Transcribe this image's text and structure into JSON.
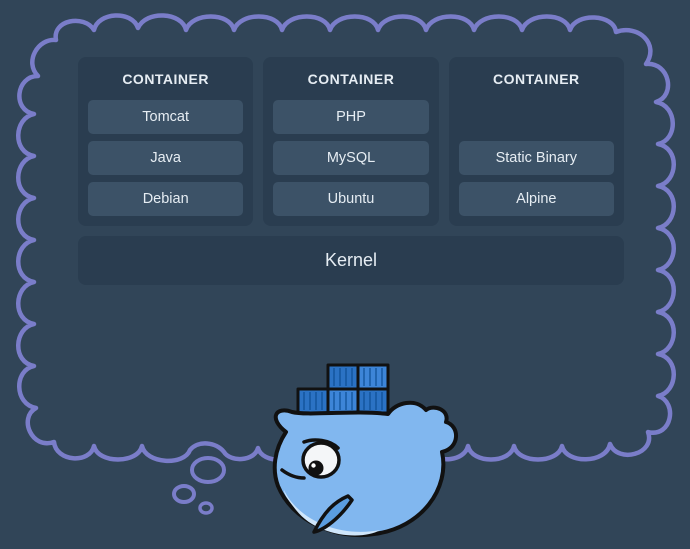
{
  "containers": [
    {
      "title": "CONTAINER",
      "layers": [
        "Tomcat",
        "Java",
        "Debian"
      ]
    },
    {
      "title": "CONTAINER",
      "layers": [
        "PHP",
        "MySQL",
        "Ubuntu"
      ]
    },
    {
      "title": "CONTAINER",
      "layers": [
        "",
        "Static Binary",
        "Alpine"
      ]
    }
  ],
  "kernel_label": "Kernel"
}
